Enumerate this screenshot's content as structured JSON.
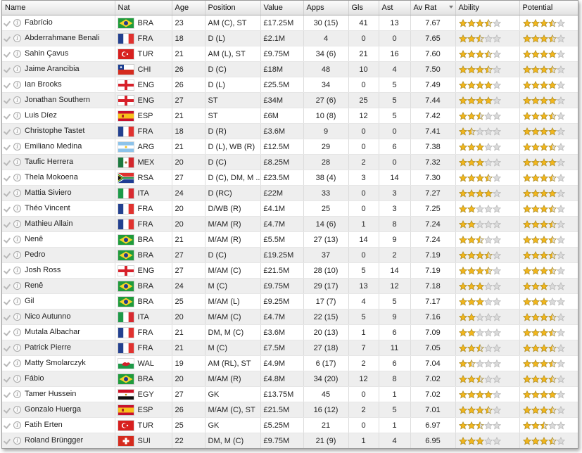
{
  "columns": {
    "name": "Name",
    "nat": "Nat",
    "age": "Age",
    "position": "Position",
    "value": "Value",
    "apps": "Apps",
    "gls": "Gls",
    "ast": "Ast",
    "avrat": "Av Rat",
    "ability": "Ability",
    "potential": "Potential"
  },
  "colors": {
    "star_on": "#f2b61c",
    "star_off": "#dadada",
    "star_stroke": "#a98a25"
  },
  "players": [
    {
      "name": "Fabrício",
      "nat": "BRA",
      "age": "23",
      "position": "AM (C), ST",
      "value": "£17.25M",
      "apps": "30 (15)",
      "gls": "41",
      "ast": "13",
      "avrat": "7.67",
      "ability": 3.5,
      "potential": 3.5
    },
    {
      "name": "Abderrahmane Benali",
      "nat": "FRA",
      "age": "18",
      "position": "D (L)",
      "value": "£2.1M",
      "apps": "4",
      "gls": "0",
      "ast": "0",
      "avrat": "7.65",
      "ability": 2.5,
      "potential": 3.5
    },
    {
      "name": "Sahin Çavus",
      "nat": "TUR",
      "age": "21",
      "position": "AM (L), ST",
      "value": "£9.75M",
      "apps": "34 (6)",
      "gls": "21",
      "ast": "16",
      "avrat": "7.60",
      "ability": 3.5,
      "potential": 4
    },
    {
      "name": "Jaime Arancibia",
      "nat": "CHI",
      "age": "26",
      "position": "D (C)",
      "value": "£18M",
      "apps": "48",
      "gls": "10",
      "ast": "4",
      "avrat": "7.50",
      "ability": 3.5,
      "potential": 3.5
    },
    {
      "name": "Ian Brooks",
      "nat": "ENG",
      "age": "26",
      "position": "D (L)",
      "value": "£25.5M",
      "apps": "34",
      "gls": "0",
      "ast": "5",
      "avrat": "7.49",
      "ability": 4,
      "potential": 4
    },
    {
      "name": "Jonathan Southern",
      "nat": "ENG",
      "age": "27",
      "position": "ST",
      "value": "£34M",
      "apps": "27 (6)",
      "gls": "25",
      "ast": "5",
      "avrat": "7.44",
      "ability": 4,
      "potential": 4
    },
    {
      "name": "Luis Díez",
      "nat": "ESP",
      "age": "21",
      "position": "ST",
      "value": "£6M",
      "apps": "10 (8)",
      "gls": "12",
      "ast": "5",
      "avrat": "7.42",
      "ability": 2.5,
      "potential": 3.5
    },
    {
      "name": "Christophe Tastet",
      "nat": "FRA",
      "age": "18",
      "position": "D (R)",
      "value": "£3.6M",
      "apps": "9",
      "gls": "0",
      "ast": "0",
      "avrat": "7.41",
      "ability": 1.5,
      "potential": 4
    },
    {
      "name": "Emiliano Medina",
      "nat": "ARG",
      "age": "21",
      "position": "D (L), WB (R)",
      "value": "£12.5M",
      "apps": "29",
      "gls": "0",
      "ast": "6",
      "avrat": "7.38",
      "ability": 3,
      "potential": 3.5
    },
    {
      "name": "Taufic Herrera",
      "nat": "MEX",
      "age": "20",
      "position": "D (C)",
      "value": "£8.25M",
      "apps": "28",
      "gls": "2",
      "ast": "0",
      "avrat": "7.32",
      "ability": 3,
      "potential": 4
    },
    {
      "name": "Thela Mokoena",
      "nat": "RSA",
      "age": "27",
      "position": "D (C), DM, M ..",
      "value": "£23.5M",
      "apps": "38 (4)",
      "gls": "3",
      "ast": "14",
      "avrat": "7.30",
      "ability": 3.5,
      "potential": 3.5
    },
    {
      "name": "Mattia Siviero",
      "nat": "ITA",
      "age": "24",
      "position": "D (RC)",
      "value": "£22M",
      "apps": "33",
      "gls": "0",
      "ast": "3",
      "avrat": "7.27",
      "ability": 4,
      "potential": 4
    },
    {
      "name": "Théo Vincent",
      "nat": "FRA",
      "age": "20",
      "position": "D/WB (R)",
      "value": "£4.1M",
      "apps": "25",
      "gls": "0",
      "ast": "3",
      "avrat": "7.25",
      "ability": 2,
      "potential": 3.5
    },
    {
      "name": "Mathieu Allain",
      "nat": "FRA",
      "age": "20",
      "position": "M/AM (R)",
      "value": "£4.7M",
      "apps": "14 (6)",
      "gls": "1",
      "ast": "8",
      "avrat": "7.24",
      "ability": 2,
      "potential": 3.5
    },
    {
      "name": "Nenê",
      "nat": "BRA",
      "age": "21",
      "position": "M/AM (R)",
      "value": "£5.5M",
      "apps": "27 (13)",
      "gls": "14",
      "ast": "9",
      "avrat": "7.24",
      "ability": 2.5,
      "potential": 3.5
    },
    {
      "name": "Pedro",
      "nat": "BRA",
      "age": "27",
      "position": "D (C)",
      "value": "£19.25M",
      "apps": "37",
      "gls": "0",
      "ast": "2",
      "avrat": "7.19",
      "ability": 3.5,
      "potential": 3.5
    },
    {
      "name": "Josh Ross",
      "nat": "ENG",
      "age": "27",
      "position": "M/AM (C)",
      "value": "£21.5M",
      "apps": "28 (10)",
      "gls": "5",
      "ast": "14",
      "avrat": "7.19",
      "ability": 3.5,
      "potential": 3.5
    },
    {
      "name": "Renê",
      "nat": "BRA",
      "age": "24",
      "position": "M (C)",
      "value": "£9.75M",
      "apps": "29 (17)",
      "gls": "13",
      "ast": "12",
      "avrat": "7.18",
      "ability": 3,
      "potential": 3
    },
    {
      "name": "Gil",
      "nat": "BRA",
      "age": "25",
      "position": "M/AM (L)",
      "value": "£9.25M",
      "apps": "17 (7)",
      "gls": "4",
      "ast": "5",
      "avrat": "7.17",
      "ability": 3,
      "potential": 3
    },
    {
      "name": "Nico Autunno",
      "nat": "ITA",
      "age": "20",
      "position": "M/AM (C)",
      "value": "£4.7M",
      "apps": "22 (15)",
      "gls": "5",
      "ast": "9",
      "avrat": "7.16",
      "ability": 2,
      "potential": 3.5
    },
    {
      "name": "Mutala Albachar",
      "nat": "FRA",
      "age": "21",
      "position": "DM, M (C)",
      "value": "£3.6M",
      "apps": "20 (13)",
      "gls": "1",
      "ast": "6",
      "avrat": "7.09",
      "ability": 2,
      "potential": 3.5
    },
    {
      "name": "Patrick Pierre",
      "nat": "FRA",
      "age": "21",
      "position": "M (C)",
      "value": "£7.5M",
      "apps": "27 (18)",
      "gls": "7",
      "ast": "11",
      "avrat": "7.05",
      "ability": 2.5,
      "potential": 3.5
    },
    {
      "name": "Matty Smolarczyk",
      "nat": "WAL",
      "age": "19",
      "position": "AM (RL), ST",
      "value": "£4.9M",
      "apps": "6 (17)",
      "gls": "2",
      "ast": "6",
      "avrat": "7.04",
      "ability": 1.5,
      "potential": 3.5
    },
    {
      "name": "Fábio",
      "nat": "BRA",
      "age": "20",
      "position": "M/AM (R)",
      "value": "£4.8M",
      "apps": "34 (20)",
      "gls": "12",
      "ast": "8",
      "avrat": "7.02",
      "ability": 2.5,
      "potential": 3.5
    },
    {
      "name": "Tamer Hussein",
      "nat": "EGY",
      "age": "27",
      "position": "GK",
      "value": "£13.75M",
      "apps": "45",
      "gls": "0",
      "ast": "1",
      "avrat": "7.02",
      "ability": 4,
      "potential": 4
    },
    {
      "name": "Gonzalo Huerga",
      "nat": "ESP",
      "age": "26",
      "position": "M/AM (C), ST",
      "value": "£21.5M",
      "apps": "16 (12)",
      "gls": "2",
      "ast": "5",
      "avrat": "7.01",
      "ability": 3.5,
      "potential": 3.5
    },
    {
      "name": "Fatih Erten",
      "nat": "TUR",
      "age": "25",
      "position": "GK",
      "value": "£5.25M",
      "apps": "21",
      "gls": "0",
      "ast": "1",
      "avrat": "6.97",
      "ability": 2.5,
      "potential": 2.5
    },
    {
      "name": "Roland Brüngger",
      "nat": "SUI",
      "age": "22",
      "position": "DM, M (C)",
      "value": "£9.75M",
      "apps": "21 (9)",
      "gls": "1",
      "ast": "4",
      "avrat": "6.95",
      "ability": 3,
      "potential": 3.5
    }
  ]
}
